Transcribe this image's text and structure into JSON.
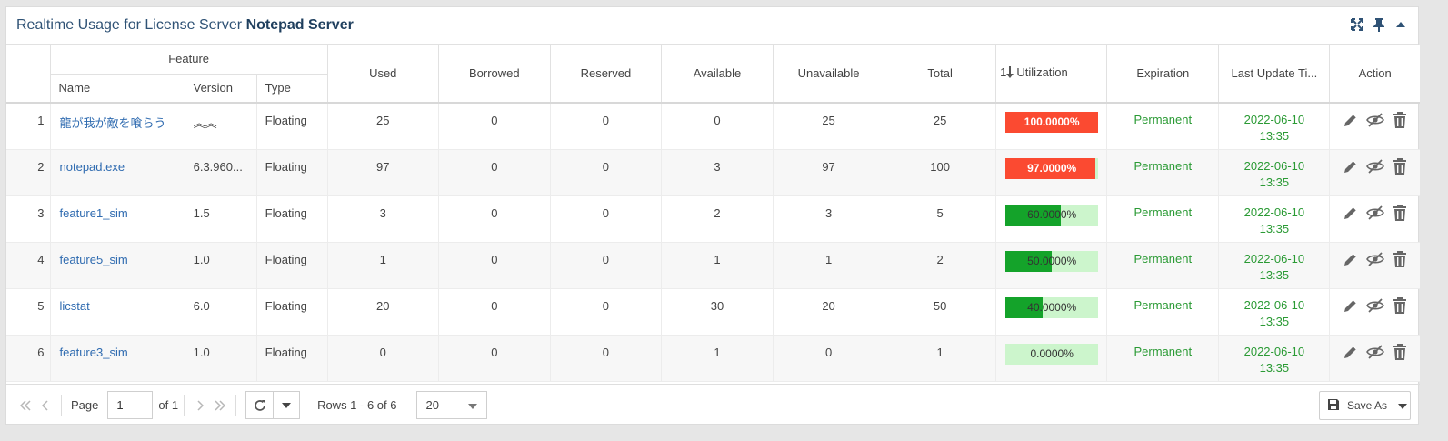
{
  "panel": {
    "title_prefix": "Realtime Usage for License Server",
    "title_server": "Notepad Server",
    "icons": [
      "expand-icon",
      "pin-icon",
      "collapse-up-icon"
    ]
  },
  "table": {
    "group_header": "Feature",
    "columns": {
      "name": "Name",
      "version": "Version",
      "type": "Type",
      "used": "Used",
      "borrowed": "Borrowed",
      "reserved": "Reserved",
      "available": "Available",
      "unavailable": "Unavailable",
      "total": "Total",
      "utilization_sort": "1",
      "utilization": "Utilization",
      "expiration": "Expiration",
      "last_update": "Last Update Ti...",
      "action": "Action"
    },
    "rows": [
      {
        "idx": "1",
        "name": "龍が我が敵を喰らう",
        "version": "︽︽",
        "type": "Floating",
        "used": "25",
        "borrowed": "0",
        "reserved": "0",
        "available": "0",
        "unavailable": "25",
        "total": "25",
        "utilization": "100.0000%",
        "util_fraction": 1.0,
        "util_status": "red",
        "expiration": "Permanent",
        "update_date": "2022-06-10",
        "update_time": "13:35"
      },
      {
        "idx": "2",
        "name": "notepad.exe",
        "version": "6.3.960...",
        "type": "Floating",
        "used": "97",
        "borrowed": "0",
        "reserved": "0",
        "available": "3",
        "unavailable": "97",
        "total": "100",
        "utilization": "97.0000%",
        "util_fraction": 0.97,
        "util_status": "red",
        "expiration": "Permanent",
        "update_date": "2022-06-10",
        "update_time": "13:35"
      },
      {
        "idx": "3",
        "name": "feature1_sim",
        "version": "1.5",
        "type": "Floating",
        "used": "3",
        "borrowed": "0",
        "reserved": "0",
        "available": "2",
        "unavailable": "3",
        "total": "5",
        "utilization": "60.0000%",
        "util_fraction": 0.6,
        "util_status": "green",
        "expiration": "Permanent",
        "update_date": "2022-06-10",
        "update_time": "13:35"
      },
      {
        "idx": "4",
        "name": "feature5_sim",
        "version": "1.0",
        "type": "Floating",
        "used": "1",
        "borrowed": "0",
        "reserved": "0",
        "available": "1",
        "unavailable": "1",
        "total": "2",
        "utilization": "50.0000%",
        "util_fraction": 0.5,
        "util_status": "green",
        "expiration": "Permanent",
        "update_date": "2022-06-10",
        "update_time": "13:35"
      },
      {
        "idx": "5",
        "name": "licstat",
        "version": "6.0",
        "type": "Floating",
        "used": "20",
        "borrowed": "0",
        "reserved": "0",
        "available": "30",
        "unavailable": "20",
        "total": "50",
        "utilization": "40.0000%",
        "util_fraction": 0.4,
        "util_status": "green",
        "expiration": "Permanent",
        "update_date": "2022-06-10",
        "update_time": "13:35"
      },
      {
        "idx": "6",
        "name": "feature3_sim",
        "version": "1.0",
        "type": "Floating",
        "used": "0",
        "borrowed": "0",
        "reserved": "0",
        "available": "1",
        "unavailable": "0",
        "total": "1",
        "utilization": "0.0000%",
        "util_fraction": 0.0,
        "util_status": "green",
        "expiration": "Permanent",
        "update_date": "2022-06-10",
        "update_time": "13:35"
      }
    ],
    "row_actions": [
      "edit-icon",
      "hide-icon",
      "delete-icon"
    ]
  },
  "footer": {
    "page_label": "Page",
    "page_value": "1",
    "of_label": "of 1",
    "rows_info": "Rows 1 - 6 of 6",
    "page_size": "20",
    "save_as": "Save As"
  },
  "colors": {
    "red": "#fb4a31",
    "green": "#14a32a",
    "light_green": "#ccf5cc",
    "link": "#2f6bb0",
    "permanent": "#2a9a34"
  }
}
